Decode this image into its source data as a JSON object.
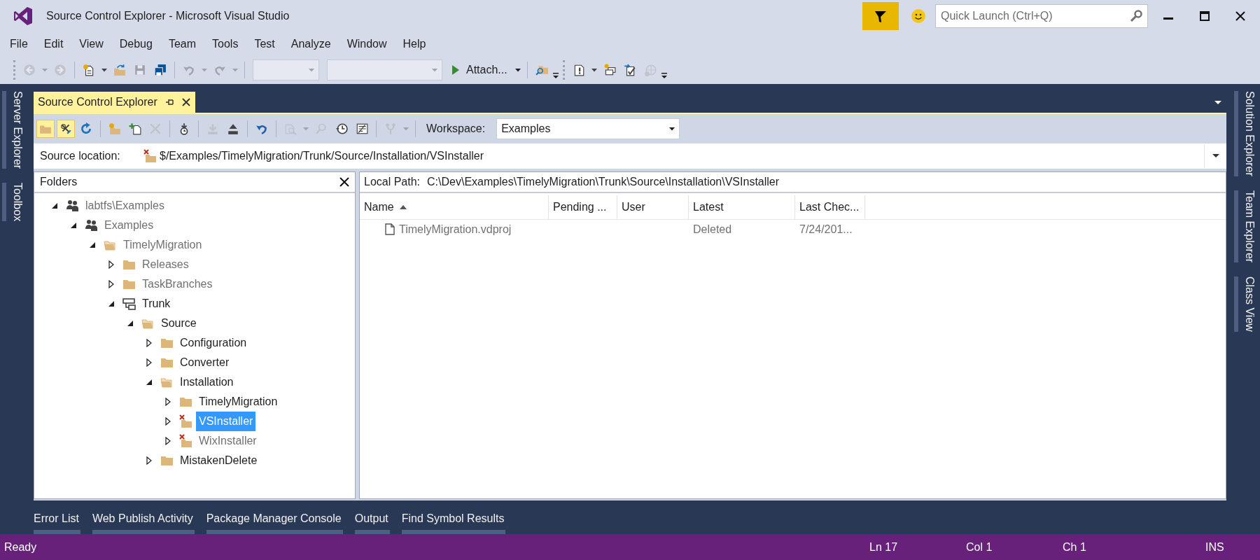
{
  "window": {
    "title": "Source Control Explorer - Microsoft Visual Studio"
  },
  "quick_launch": {
    "placeholder": "Quick Launch (Ctrl+Q)"
  },
  "menu": [
    "File",
    "Edit",
    "View",
    "Debug",
    "Team",
    "Tools",
    "Test",
    "Analyze",
    "Window",
    "Help"
  ],
  "toolbars": [
    {
      "groups": [
        [
          {
            "kind": "back",
            "disabled": true,
            "dropdown": true
          },
          {
            "kind": "forward",
            "disabled": true,
            "dropdown": false
          }
        ],
        [
          {
            "kind": "new-project",
            "disabled": false,
            "dropdown": true
          },
          {
            "kind": "open",
            "disabled": false,
            "dropdown": false
          },
          {
            "kind": "save",
            "disabled": true,
            "dropdown": false
          },
          {
            "kind": "save-all",
            "disabled": false,
            "dropdown": false
          }
        ],
        [
          {
            "kind": "undo",
            "disabled": true,
            "dropdown": true
          },
          {
            "kind": "redo",
            "disabled": true,
            "dropdown": true
          }
        ],
        [
          {
            "kind": "combo-small",
            "disabled": true,
            "dropdown": true
          },
          {
            "kind": "combo-large",
            "disabled": true,
            "dropdown": true
          },
          {
            "kind": "run",
            "disabled": false,
            "dropdown": true,
            "label": "Attach..."
          }
        ],
        [
          {
            "kind": "find-folder",
            "disabled": false,
            "dropdown": false
          }
        ]
      ]
    },
    {
      "groups": [
        [
          {
            "kind": "error-list",
            "disabled": false,
            "dropdown": true
          },
          {
            "kind": "class-view",
            "disabled": false,
            "dropdown": false
          },
          {
            "kind": "checkin",
            "disabled": false,
            "dropdown": false
          },
          {
            "kind": "web",
            "disabled": true,
            "dropdown": false
          }
        ]
      ]
    }
  ],
  "side_tabs_left": [
    "Server Explorer",
    "Toolbox"
  ],
  "side_tabs_right": [
    "Solution Explorer",
    "Team Explorer",
    "Class View"
  ],
  "explorer": {
    "tab_title": "Source Control Explorer",
    "toolbar_groups": [
      [
        {
          "kind": "folders",
          "disabled": false,
          "pressed": true,
          "dropdown": false
        },
        {
          "kind": "workspaces",
          "disabled": false,
          "pressed": true,
          "dropdown": false
        },
        {
          "kind": "refresh",
          "disabled": false,
          "pressed": false,
          "dropdown": false
        }
      ],
      [
        {
          "kind": "new-folder",
          "disabled": false,
          "pressed": false,
          "dropdown": false
        },
        {
          "kind": "add-file",
          "disabled": false,
          "pressed": false,
          "dropdown": false
        },
        {
          "kind": "delete",
          "disabled": true,
          "pressed": false,
          "dropdown": false
        }
      ],
      [
        {
          "kind": "get-latest",
          "disabled": false,
          "pressed": false,
          "dropdown": false
        }
      ],
      [
        {
          "kind": "download",
          "disabled": true,
          "pressed": false,
          "dropdown": false
        },
        {
          "kind": "upload",
          "disabled": false,
          "pressed": false,
          "dropdown": false
        }
      ],
      [
        {
          "kind": "undo",
          "disabled": false,
          "pressed": false,
          "dropdown": false
        }
      ],
      [
        {
          "kind": "compare",
          "disabled": true,
          "pressed": false,
          "dropdown": true
        },
        {
          "kind": "find",
          "disabled": true,
          "pressed": false,
          "dropdown": false
        },
        {
          "kind": "history",
          "disabled": false,
          "pressed": false,
          "dropdown": false
        },
        {
          "kind": "annotate",
          "disabled": false,
          "pressed": false,
          "dropdown": false
        }
      ],
      [
        {
          "kind": "branch",
          "disabled": true,
          "pressed": false,
          "dropdown": true
        }
      ]
    ],
    "workspace_label": "Workspace:",
    "workspace": "Examples",
    "source_location_label": "Source location:",
    "source_location": "$/Examples/TimelyMigration/Trunk/Source/Installation/VSInstaller",
    "folders_title": "Folders",
    "tree": [
      {
        "label": "labtfs\\Examples",
        "kind": "team",
        "expanded": true,
        "selected": false,
        "dimmed": true,
        "deleted": false,
        "children": [
          {
            "label": "Examples",
            "kind": "team",
            "expanded": true,
            "selected": false,
            "dimmed": true,
            "deleted": false,
            "children": [
              {
                "label": "TimelyMigration",
                "kind": "folder",
                "expanded": true,
                "selected": false,
                "dimmed": true,
                "deleted": false,
                "children": [
                  {
                    "label": "Releases",
                    "kind": "folder",
                    "expanded": false,
                    "selected": false,
                    "dimmed": true,
                    "deleted": false
                  },
                  {
                    "label": "TaskBranches",
                    "kind": "folder",
                    "expanded": false,
                    "selected": false,
                    "dimmed": true,
                    "deleted": false
                  },
                  {
                    "label": "Trunk",
                    "kind": "branch",
                    "expanded": true,
                    "selected": false,
                    "dimmed": false,
                    "deleted": false,
                    "children": [
                      {
                        "label": "Source",
                        "kind": "folder",
                        "expanded": true,
                        "selected": false,
                        "dimmed": false,
                        "deleted": false,
                        "children": [
                          {
                            "label": "Configuration",
                            "kind": "folder",
                            "expanded": false,
                            "selected": false,
                            "dimmed": false,
                            "deleted": false
                          },
                          {
                            "label": "Converter",
                            "kind": "folder",
                            "expanded": false,
                            "selected": false,
                            "dimmed": false,
                            "deleted": false
                          },
                          {
                            "label": "Installation",
                            "kind": "folder",
                            "expanded": true,
                            "selected": false,
                            "dimmed": false,
                            "deleted": false,
                            "children": [
                              {
                                "label": "TimelyMigration",
                                "kind": "folder",
                                "expanded": false,
                                "selected": false,
                                "dimmed": false,
                                "deleted": false
                              },
                              {
                                "label": "VSInstaller",
                                "kind": "folder",
                                "expanded": false,
                                "selected": true,
                                "dimmed": false,
                                "deleted": true
                              },
                              {
                                "label": "WixInstaller",
                                "kind": "folder",
                                "expanded": false,
                                "selected": false,
                                "dimmed": true,
                                "deleted": true
                              }
                            ]
                          },
                          {
                            "label": "MistakenDelete",
                            "kind": "folder",
                            "expanded": false,
                            "selected": false,
                            "dimmed": false,
                            "deleted": false
                          }
                        ]
                      }
                    ]
                  }
                ]
              }
            ]
          }
        ]
      }
    ],
    "local_path_label": "Local Path:",
    "local_path": "C:\\Dev\\Examples\\TimelyMigration\\Trunk\\Source\\Installation\\VSInstaller",
    "columns": [
      {
        "label": "Name",
        "sorted": true
      },
      {
        "label": "Pending ...",
        "sorted": false
      },
      {
        "label": "User",
        "sorted": false
      },
      {
        "label": "Latest",
        "sorted": false
      },
      {
        "label": "Last Chec...",
        "sorted": false
      }
    ],
    "rows": [
      {
        "name": "TimelyMigration.vdproj",
        "latest": "Deleted",
        "last_check_in": "7/24/201...",
        "dimmed": true
      }
    ]
  },
  "bottom_tabs": [
    "Error List",
    "Web Publish Activity",
    "Package Manager Console",
    "Output",
    "Find Symbol Results"
  ],
  "status_bar": {
    "text": "Ready",
    "line": "Ln 17",
    "column": "Col 1",
    "char": "Ch 1",
    "mode": "INS"
  }
}
